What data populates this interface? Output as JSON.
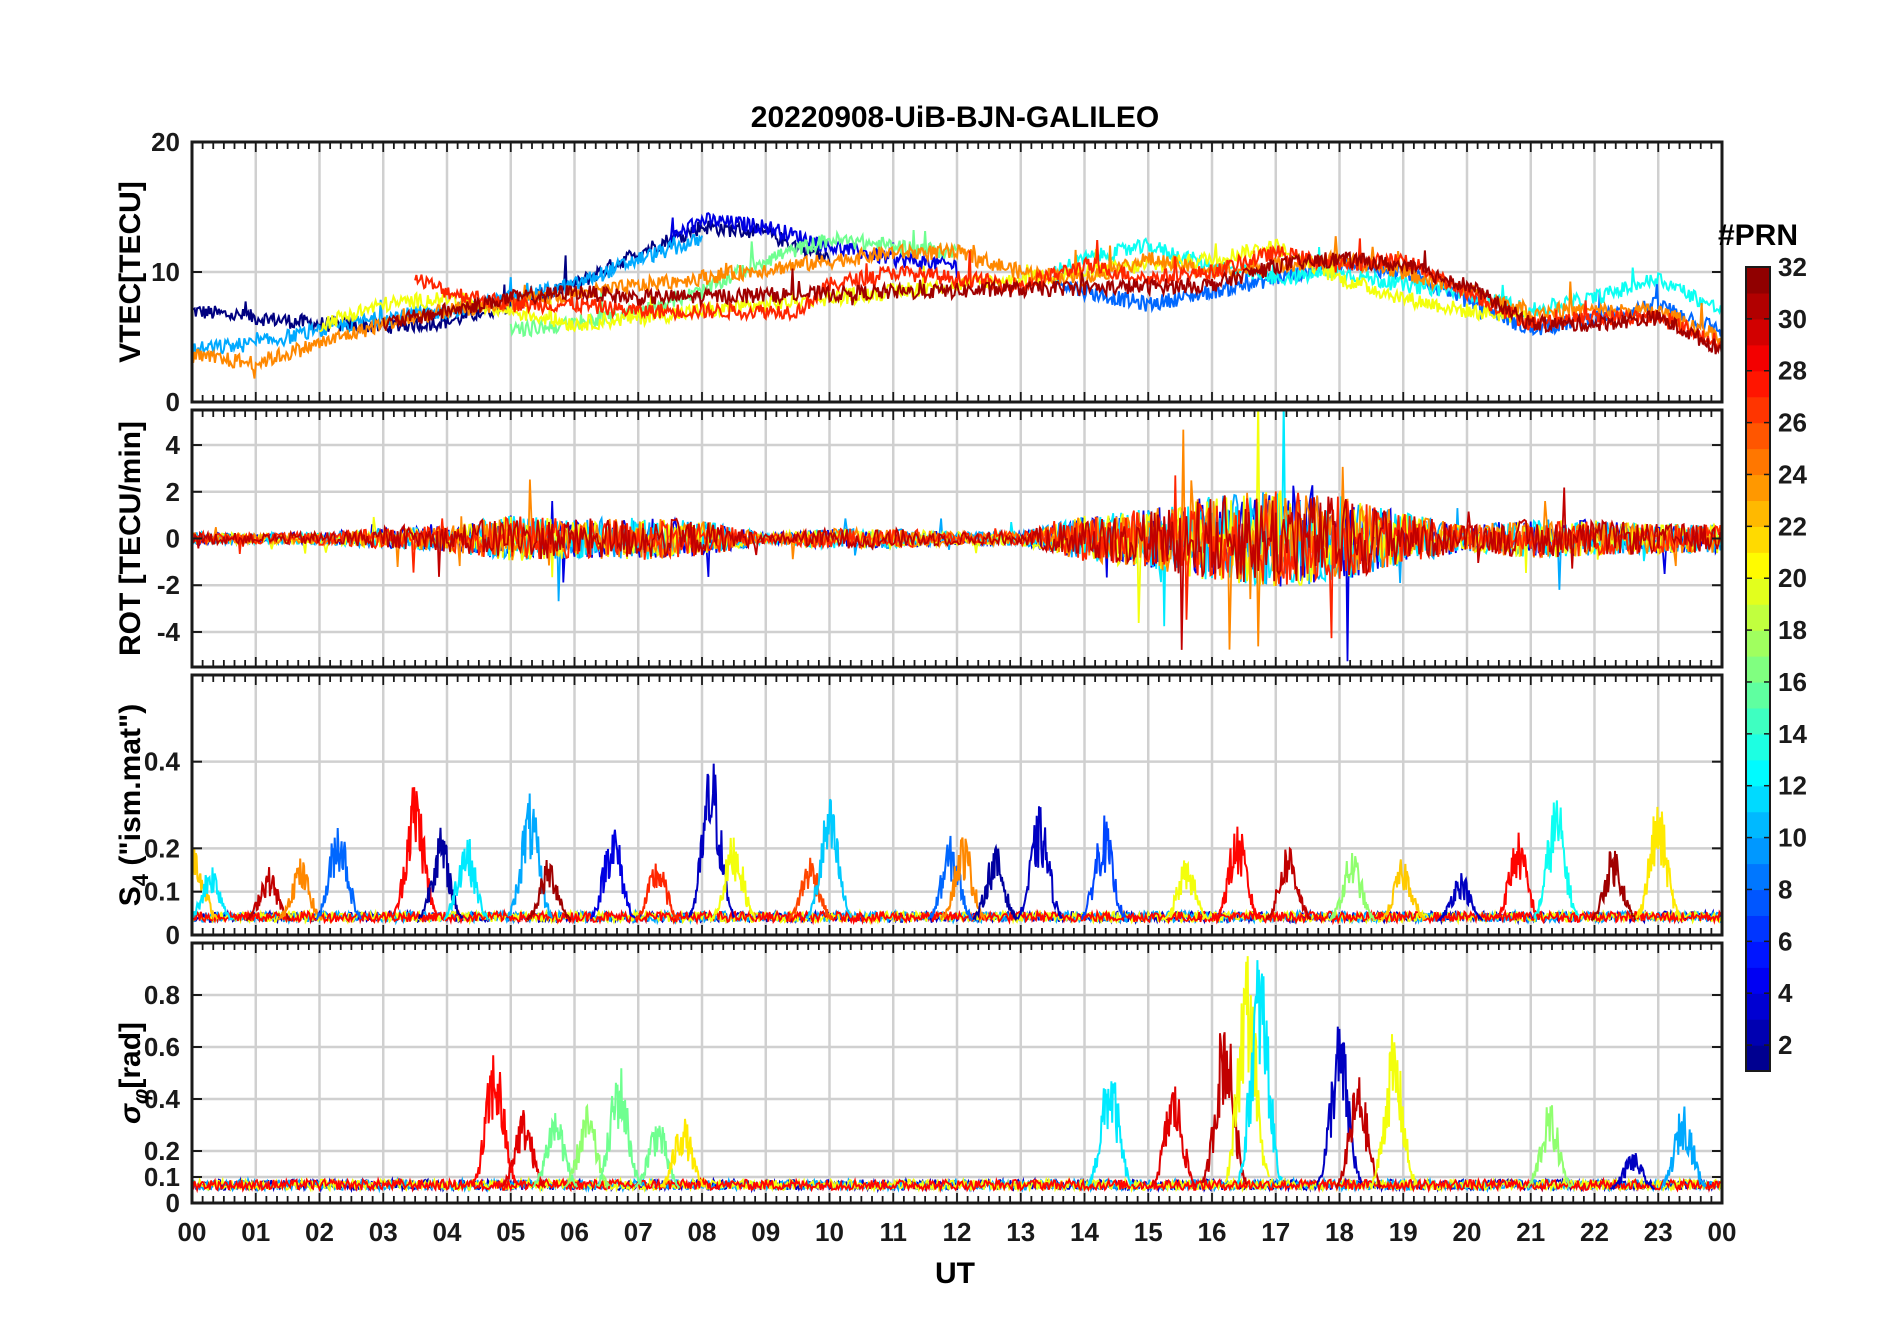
{
  "chart_data": {
    "type": "line",
    "title": "20220908-UiB-BJN-GALILEO",
    "xlabel": "UT",
    "x_tick_labels": [
      "00",
      "01",
      "02",
      "03",
      "04",
      "05",
      "06",
      "07",
      "08",
      "09",
      "10",
      "11",
      "12",
      "13",
      "14",
      "15",
      "16",
      "17",
      "18",
      "19",
      "20",
      "21",
      "22",
      "23",
      "00"
    ],
    "xlim": [
      0,
      24
    ],
    "grid": true,
    "colorbar": {
      "label": "#PRN",
      "range": [
        1,
        32
      ],
      "colormap": "jet",
      "tick_labels": [
        "2",
        "4",
        "6",
        "8",
        "10",
        "12",
        "14",
        "16",
        "18",
        "20",
        "22",
        "24",
        "26",
        "28",
        "30",
        "32"
      ]
    },
    "panels": [
      {
        "id": "vtec",
        "ylabel": "VTEC[TECU]",
        "ylim": [
          0,
          20
        ],
        "y_tick_values": [
          0,
          10,
          20
        ],
        "y_tick_labels": [
          "0",
          "10",
          "20"
        ],
        "series_color_by": "PRN",
        "series": [
          {
            "prn": 1,
            "x": [
              0,
              1,
              2,
              3,
              4,
              5,
              6,
              7,
              8,
              9,
              10
            ],
            "y": [
              7.0,
              6.5,
              6.0,
              5.8,
              6.2,
              7.5,
              9.0,
              11.5,
              13.5,
              13.0,
              11.0
            ]
          },
          {
            "prn": 4,
            "x": [
              7.5,
              8,
              9,
              10,
              11,
              12
            ],
            "y": [
              12.5,
              14.0,
              13.5,
              12.0,
              11.0,
              10.5
            ]
          },
          {
            "prn": 8,
            "x": [
              13.5,
              14,
              15,
              16,
              17,
              18,
              19,
              20,
              21,
              22,
              23,
              24
            ],
            "y": [
              9.5,
              8.5,
              7.5,
              8.5,
              9.5,
              10.5,
              10.0,
              8.0,
              5.5,
              6.5,
              7.5,
              5.5
            ]
          },
          {
            "prn": 10,
            "x": [
              0,
              1,
              2,
              3,
              4,
              5,
              6,
              7,
              8
            ],
            "y": [
              4.0,
              4.5,
              5.5,
              6.5,
              7.0,
              8.0,
              9.0,
              11.0,
              12.5
            ]
          },
          {
            "prn": 13,
            "x": [
              13.5,
              14,
              15,
              16,
              17,
              18,
              19,
              20,
              21,
              22,
              23,
              24
            ],
            "y": [
              10.0,
              11.0,
              12.0,
              10.5,
              9.5,
              10.0,
              9.0,
              8.5,
              7.0,
              8.0,
              9.5,
              7.0
            ]
          },
          {
            "prn": 16,
            "x": [
              5,
              6,
              7,
              8,
              9,
              10,
              11,
              12
            ],
            "y": [
              5.5,
              6.0,
              7.0,
              8.5,
              11.0,
              12.5,
              12.0,
              11.5
            ]
          },
          {
            "prn": 20,
            "x": [
              2,
              3,
              4,
              5,
              6,
              16,
              17,
              18,
              19,
              20,
              21
            ],
            "y": [
              6.0,
              7.5,
              8.0,
              7.0,
              6.0,
              11.0,
              12.0,
              9.5,
              8.0,
              7.0,
              6.5
            ]
          },
          {
            "prn": 24,
            "x": [
              0,
              1,
              2,
              3,
              4,
              11,
              12,
              13,
              14,
              15,
              16,
              17,
              18,
              19,
              20,
              21,
              22,
              23,
              24
            ],
            "y": [
              3.5,
              3.0,
              4.5,
              6.0,
              7.0,
              11.5,
              11.5,
              10.0,
              9.5,
              11.0,
              10.0,
              10.5,
              11.0,
              10.0,
              8.5,
              7.0,
              7.0,
              7.0,
              5.0
            ]
          },
          {
            "prn": 27,
            "x": [
              3.5,
              4,
              5,
              6,
              7,
              9.5,
              10,
              11,
              12,
              13,
              14,
              15,
              16,
              17,
              18,
              19,
              20,
              21,
              22,
              23,
              24
            ],
            "y": [
              9.5,
              8.5,
              7.5,
              7.5,
              7.0,
              7.0,
              9.0,
              10.0,
              9.5,
              9.0,
              10.5,
              9.5,
              10.0,
              11.5,
              10.5,
              11.0,
              8.5,
              6.0,
              6.5,
              6.5,
              4.5
            ]
          },
          {
            "prn": 31,
            "x": [
              3,
              4,
              5,
              6,
              7,
              16,
              17,
              18,
              19,
              20,
              21,
              22,
              23,
              24
            ],
            "y": [
              6.0,
              7.0,
              8.0,
              8.5,
              8.0,
              9.0,
              10.5,
              11.0,
              10.5,
              9.0,
              6.0,
              6.0,
              6.5,
              4.0
            ]
          }
        ]
      },
      {
        "id": "rot",
        "ylabel": "ROT [TECU/min]",
        "ylim": [
          -5.5,
          5.5
        ],
        "y_tick_values": [
          -4,
          -2,
          0,
          2,
          4
        ],
        "y_tick_labels": [
          "-4",
          "-2",
          "0",
          "2",
          "4"
        ],
        "series_color_by": "PRN",
        "envelope": {
          "x": [
            0,
            1,
            2,
            3,
            4,
            5,
            6,
            7,
            8,
            9,
            10,
            11,
            12,
            13,
            14,
            15,
            16,
            17,
            18,
            19,
            20,
            21,
            22,
            23,
            24
          ],
          "amplitude": [
            0.4,
            0.3,
            0.4,
            0.6,
            0.8,
            1.4,
            1.2,
            1.3,
            1.1,
            0.3,
            0.6,
            0.6,
            0.4,
            0.4,
            1.4,
            1.8,
            2.6,
            3.0,
            2.6,
            1.6,
            0.8,
            1.2,
            1.1,
            0.9,
            0.9
          ]
        }
      },
      {
        "id": "s4",
        "ylabel": "S_4 (\"ism.mat\")",
        "ylim": [
          0,
          0.6
        ],
        "y_tick_values": [
          0,
          0.1,
          0.2,
          0.4
        ],
        "y_tick_labels": [
          "0",
          "0.1",
          "0.2",
          "0.4"
        ],
        "series_color_by": "PRN",
        "baseline": 0.03,
        "peaks": [
          {
            "x": 0.05,
            "y": 0.22,
            "prn": 22
          },
          {
            "x": 0.3,
            "y": 0.17,
            "prn": 12
          },
          {
            "x": 1.2,
            "y": 0.16,
            "prn": 30
          },
          {
            "x": 1.7,
            "y": 0.18,
            "prn": 24
          },
          {
            "x": 2.3,
            "y": 0.28,
            "prn": 8
          },
          {
            "x": 3.5,
            "y": 0.37,
            "prn": 28
          },
          {
            "x": 3.9,
            "y": 0.25,
            "prn": 2
          },
          {
            "x": 4.3,
            "y": 0.24,
            "prn": 12
          },
          {
            "x": 5.3,
            "y": 0.33,
            "prn": 10
          },
          {
            "x": 5.6,
            "y": 0.18,
            "prn": 31
          },
          {
            "x": 6.6,
            "y": 0.27,
            "prn": 4
          },
          {
            "x": 7.3,
            "y": 0.18,
            "prn": 27
          },
          {
            "x": 8.15,
            "y": 0.42,
            "prn": 3
          },
          {
            "x": 8.5,
            "y": 0.24,
            "prn": 20
          },
          {
            "x": 9.7,
            "y": 0.19,
            "prn": 26
          },
          {
            "x": 10.0,
            "y": 0.32,
            "prn": 11
          },
          {
            "x": 11.9,
            "y": 0.23,
            "prn": 8
          },
          {
            "x": 12.1,
            "y": 0.24,
            "prn": 24
          },
          {
            "x": 12.6,
            "y": 0.21,
            "prn": 2
          },
          {
            "x": 13.3,
            "y": 0.3,
            "prn": 3
          },
          {
            "x": 14.3,
            "y": 0.28,
            "prn": 7
          },
          {
            "x": 15.6,
            "y": 0.18,
            "prn": 20
          },
          {
            "x": 16.4,
            "y": 0.26,
            "prn": 28
          },
          {
            "x": 17.2,
            "y": 0.22,
            "prn": 30
          },
          {
            "x": 18.2,
            "y": 0.2,
            "prn": 17
          },
          {
            "x": 19.0,
            "y": 0.18,
            "prn": 22
          },
          {
            "x": 19.9,
            "y": 0.15,
            "prn": 3
          },
          {
            "x": 20.8,
            "y": 0.24,
            "prn": 28
          },
          {
            "x": 21.4,
            "y": 0.33,
            "prn": 13
          },
          {
            "x": 22.3,
            "y": 0.21,
            "prn": 31
          },
          {
            "x": 23.0,
            "y": 0.31,
            "prn": 21
          }
        ]
      },
      {
        "id": "sigma_phi",
        "ylabel": "σ_φ[rad]",
        "ylim": [
          0,
          1.0
        ],
        "y_tick_values": [
          0,
          0.1,
          0.2,
          0.4,
          0.6,
          0.8
        ],
        "y_tick_labels": [
          "0",
          "0.1",
          "0.2",
          "0.4",
          "0.6",
          "0.8"
        ],
        "series_color_by": "PRN",
        "baseline": 0.05,
        "peaks": [
          {
            "x": 4.75,
            "y": 0.61,
            "prn": 28
          },
          {
            "x": 5.2,
            "y": 0.37,
            "prn": 29
          },
          {
            "x": 5.7,
            "y": 0.38,
            "prn": 16
          },
          {
            "x": 6.2,
            "y": 0.38,
            "prn": 17
          },
          {
            "x": 6.7,
            "y": 0.55,
            "prn": 16
          },
          {
            "x": 7.3,
            "y": 0.34,
            "prn": 16
          },
          {
            "x": 7.7,
            "y": 0.34,
            "prn": 21
          },
          {
            "x": 14.4,
            "y": 0.55,
            "prn": 12
          },
          {
            "x": 15.4,
            "y": 0.48,
            "prn": 29
          },
          {
            "x": 16.2,
            "y": 0.76,
            "prn": 30
          },
          {
            "x": 16.55,
            "y": 1.0,
            "prn": 20
          },
          {
            "x": 16.75,
            "y": 1.0,
            "prn": 12
          },
          {
            "x": 18.0,
            "y": 0.71,
            "prn": 3
          },
          {
            "x": 18.3,
            "y": 0.5,
            "prn": 30
          },
          {
            "x": 18.85,
            "y": 0.66,
            "prn": 20
          },
          {
            "x": 21.3,
            "y": 0.39,
            "prn": 17
          },
          {
            "x": 22.6,
            "y": 0.2,
            "prn": 3
          },
          {
            "x": 23.4,
            "y": 0.39,
            "prn": 10
          }
        ]
      }
    ]
  }
}
